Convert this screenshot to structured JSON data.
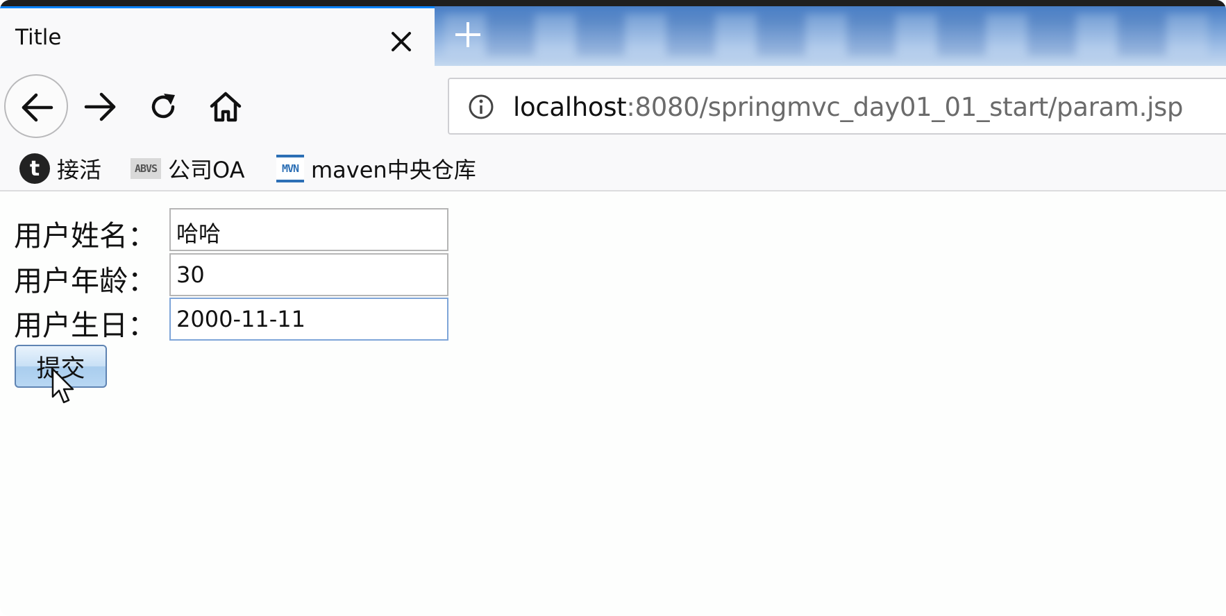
{
  "browser": {
    "tab": {
      "title": "Title"
    },
    "address_bar": {
      "host": "localhost",
      "path": ":8080/springmvc_day01_01_start/param.jsp"
    },
    "bookmarks": [
      {
        "icon": "t-circle-icon",
        "label": "接活"
      },
      {
        "icon": "abvs-icon",
        "icon_text": "ABVS",
        "label": "公司OA"
      },
      {
        "icon": "mvn-icon",
        "icon_text": "MVN",
        "label": "maven中央仓库"
      }
    ]
  },
  "form": {
    "fields": [
      {
        "label": "用户姓名：",
        "value": "哈哈"
      },
      {
        "label": "用户年龄：",
        "value": "30"
      },
      {
        "label": "用户生日：",
        "value": "2000-11-11"
      }
    ],
    "submit_label": "提交"
  }
}
